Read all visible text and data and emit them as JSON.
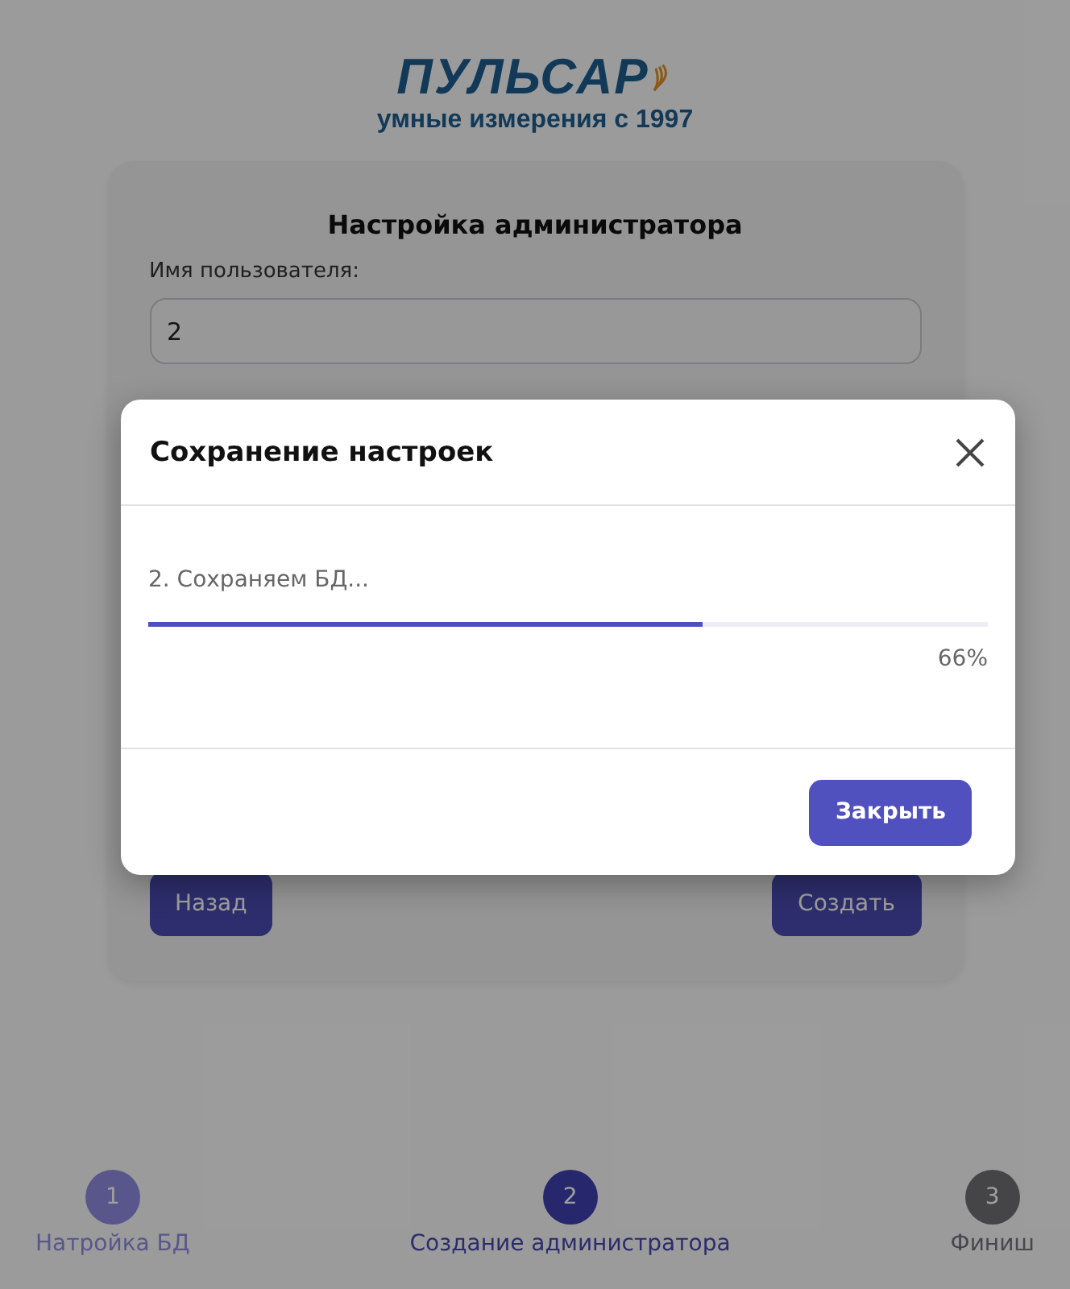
{
  "logo": {
    "name": "ПУЛЬСАР",
    "tagline": "умные измерения с 1997"
  },
  "form": {
    "title": "Настройка администратора",
    "fields": [
      {
        "label": "Имя пользователя:",
        "value": "2"
      }
    ],
    "buttons": [
      {
        "label": "Назад"
      },
      {
        "label": "Создать"
      }
    ]
  },
  "dialog": {
    "title": "Сохранение настроек",
    "step": "2. Сохраняем БД...",
    "level": 0.66,
    "percent": "66%",
    "button": "Закрыть"
  },
  "steps": [
    {
      "number": "1",
      "label": "Натройка БД",
      "done": true,
      "selected": false
    },
    {
      "number": "2",
      "label": "Создание администратора",
      "done": false,
      "selected": true
    },
    {
      "number": "3",
      "label": "Финиш",
      "done": false,
      "selected": false
    }
  ]
}
